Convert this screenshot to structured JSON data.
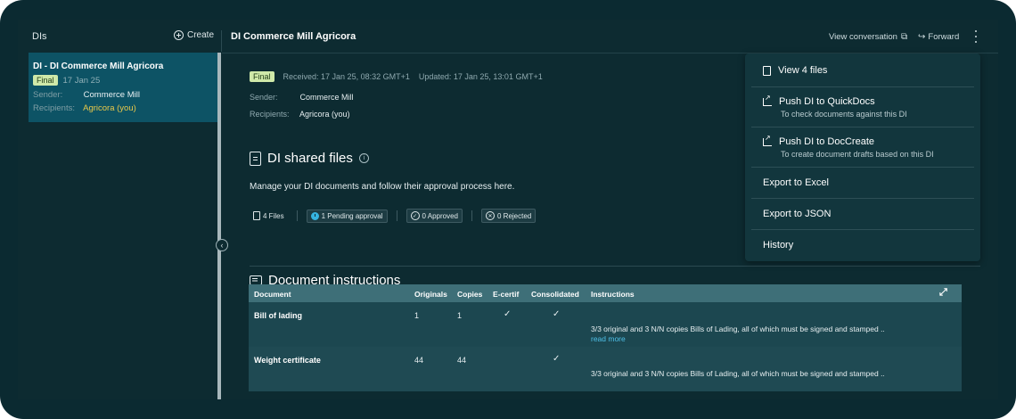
{
  "sidebar": {
    "title": "DIs",
    "create_label": "Create",
    "card": {
      "title": "DI - DI Commerce Mill Agricora",
      "status": "Final",
      "date": "17 Jan 25",
      "sender_label": "Sender:",
      "sender_value": "Commerce Mill",
      "recipients_label": "Recipients:",
      "recipients_value": "Agricora (you)"
    }
  },
  "header": {
    "title": "DI Commerce Mill Agricora",
    "view_conversation": "View conversation",
    "forward": "Forward"
  },
  "meta": {
    "status": "Final",
    "received": "Received: 17 Jan 25, 08:32 GMT+1",
    "updated": "Updated: 17 Jan 25, 13:01 GMT+1",
    "sender_label": "Sender:",
    "sender_value": "Commerce Mill",
    "recipients_label": "Recipients:",
    "recipients_value": "Agricora (you)"
  },
  "shared_files": {
    "title": "DI shared files",
    "description": "Manage your DI documents and follow their approval process here.",
    "files_count": "4 Files",
    "pending": "1 Pending approval",
    "approved": "0 Approved",
    "rejected": "0 Rejected"
  },
  "instructions": {
    "title": "Document instructions",
    "columns": [
      "Document",
      "Originals",
      "Copies",
      "E-certif",
      "Consolidated",
      "Instructions"
    ],
    "rows": [
      {
        "document": "Bill of lading",
        "originals": "1",
        "copies": "1",
        "ecertif": "✓",
        "consolidated": "✓",
        "instructions": "3/3 original and 3 N/N copies Bills of Lading, all of which must be signed and stamped ..",
        "read_more": "read more"
      },
      {
        "document": "Weight certificate",
        "originals": "44",
        "copies": "44",
        "ecertif": "",
        "consolidated": "✓",
        "instructions": "3/3 original and 3 N/N copies Bills of Lading, all of which must be signed and stamped ..",
        "read_more": ""
      }
    ]
  },
  "menu": {
    "view_files": "View 4 files",
    "push_quickdocs": "Push DI to QuickDocs",
    "push_quickdocs_sub": "To check documents against this DI",
    "push_doccreate": "Push DI to DocCreate",
    "push_doccreate_sub": "To create document drafts based on this DI",
    "export_excel": "Export to Excel",
    "export_json": "Export to JSON",
    "history": "History"
  },
  "colors": {
    "background": "#0d2b31",
    "selected_card": "#0d5365",
    "badge_final": "#cfe9a9",
    "accent_yellow": "#e8c84a",
    "link_blue": "#4fc0e8",
    "pending_blue": "#36b4e0",
    "table_header": "#3e6f78"
  }
}
